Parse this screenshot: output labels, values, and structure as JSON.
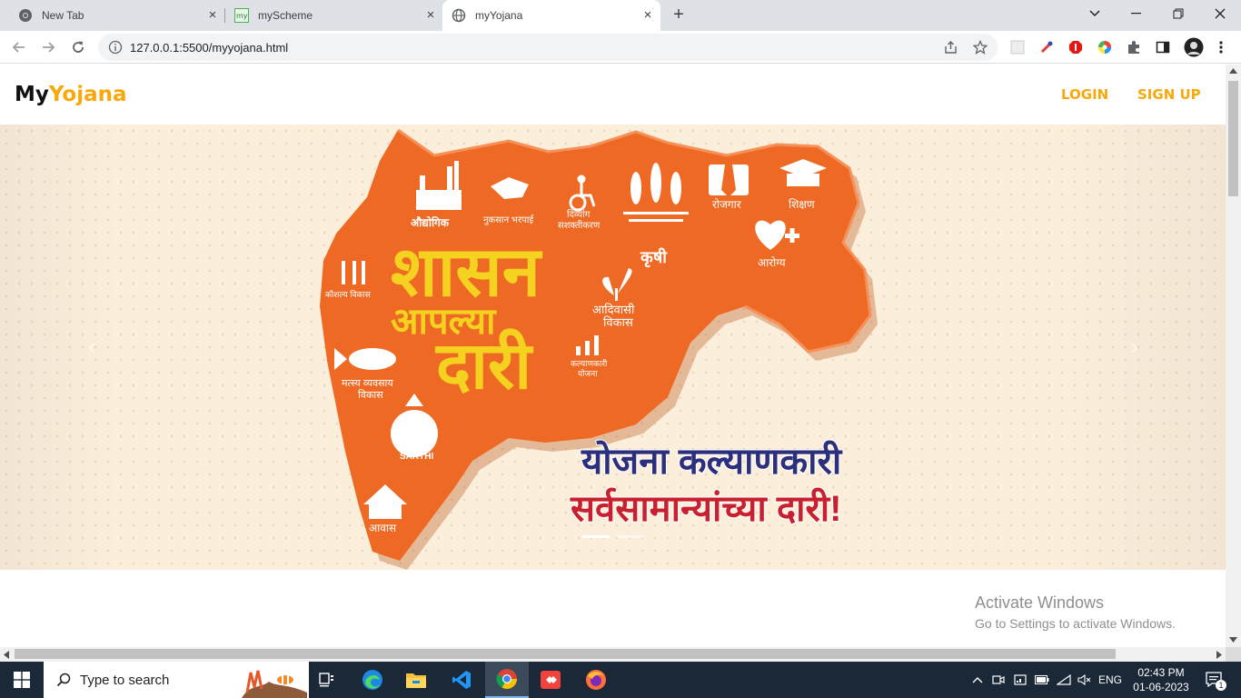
{
  "browser": {
    "tabs": [
      {
        "title": "New Tab",
        "icon": "chrome-icon"
      },
      {
        "title": "myScheme",
        "icon": "myscheme-favicon"
      },
      {
        "title": "myYojana",
        "icon": "globe-icon",
        "active": true
      }
    ],
    "url": "127.0.0.1:5500/myyojana.html"
  },
  "site": {
    "logo_part1": "My",
    "logo_part2": "Yojana",
    "login_label": "LOGIN",
    "signup_label": "SIGN UP"
  },
  "hero": {
    "big_title_line1": "शासन",
    "big_title_line2": "आपल्या",
    "big_title_line3": "दारी",
    "slogan_line1": "योजना कल्याणकारी",
    "slogan_line2": "सर्वसामान्यांच्या दारी!",
    "labels": {
      "industrial": "औद्योगिक",
      "compensation": "नुकसान भरपाई",
      "disability": "दिव्यांग",
      "empowerment": "सशक्तीकरण",
      "agriculture": "कृषी",
      "employment": "रोजगार",
      "education": "शिक्षण",
      "health": "आरोग्य",
      "skill": "कौशल्य विकास",
      "tribal1": "आदिवासी",
      "tribal2": "विकास",
      "welfare1": "कल्याणकारी",
      "welfare2": "योजना",
      "fish1": "मत्स्य व्यवसाय",
      "fish2": "विकास",
      "sarthi": "SARTHI",
      "housing": "आवास"
    },
    "colors": {
      "map": "#ee6a24",
      "title": "#f5d21f",
      "slogan1": "#2b2f7c",
      "slogan2": "#c8202f"
    }
  },
  "watermark": {
    "line1": "Activate Windows",
    "line2": "Go to Settings to activate Windows."
  },
  "taskbar": {
    "search_placeholder": "Type to search",
    "lang": "ENG",
    "time": "02:43 PM",
    "date": "01-06-2023",
    "notification_count": "1"
  }
}
